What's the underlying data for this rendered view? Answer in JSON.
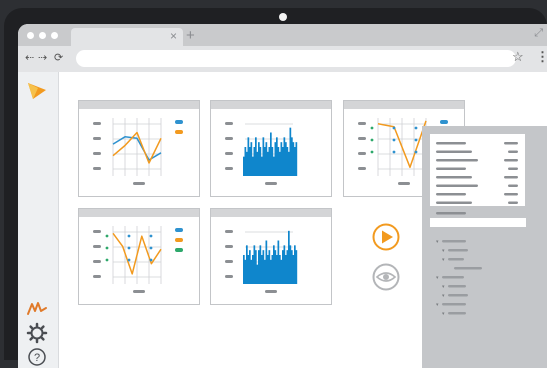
{
  "browser": {
    "new_tab_symbol": "+",
    "tab_close_symbol": "×",
    "back_icon": "arrow-left-icon",
    "forward_icon": "arrow-right-icon",
    "reload_icon": "reload-icon",
    "bookmark_icon": "star-icon",
    "menu_icon": "kebab-menu-icon",
    "url_value": ""
  },
  "sidebar": {
    "logo": "arrow-logo-icon",
    "items": [
      {
        "icon": "signature-icon"
      },
      {
        "icon": "gear-icon"
      },
      {
        "icon": "help-icon",
        "label": "?"
      }
    ]
  },
  "colors": {
    "accent": "#f29a1f",
    "series_blue": "#2f92cf",
    "bar_blue": "#0f86cc",
    "legend_green": "#2ea86b",
    "placeholder": "#8c8f93",
    "inspector_bg": "#c4c6c9"
  },
  "actions": {
    "play_icon": "play-icon",
    "preview_icon": "eye-icon"
  },
  "inspector": {
    "tree_expand_glyph": "▾"
  },
  "chart_data": [
    {
      "type": "line",
      "series": [
        {
          "values": [
            2.2,
            2.7,
            2.6,
            1.1,
            1.6
          ]
        },
        {
          "values": [
            1.4,
            2.1,
            3.0,
            0.9,
            2.6
          ]
        }
      ],
      "ylim": [
        0,
        4
      ]
    },
    {
      "type": "bar",
      "values": [
        2,
        3,
        2.5,
        4,
        3,
        3.5,
        2,
        3,
        4,
        2.5,
        3.5,
        3,
        2,
        4,
        3,
        3.5,
        2.5,
        3,
        4.5,
        3,
        2,
        3.5,
        4,
        3,
        2.5,
        3.5,
        3,
        4,
        3.5,
        3,
        2.5,
        5,
        4,
        3.5,
        3,
        3.5
      ],
      "ylim": [
        0,
        6
      ]
    },
    {
      "type": "line",
      "series": [
        {
          "values": [
            3.6,
            3.4,
            0.6,
            3.8
          ]
        }
      ],
      "ylim": [
        0,
        4
      ]
    },
    {
      "type": "line",
      "series": [
        {
          "values": [
            3.5,
            2.6,
            0.7,
            3.3,
            1.4,
            2.4
          ]
        }
      ],
      "ylim": [
        0,
        4
      ]
    },
    {
      "type": "bar",
      "values": [
        3,
        2.5,
        4,
        3,
        3.5,
        2.5,
        3,
        4,
        3.5,
        2,
        3.5,
        4,
        3,
        3.5,
        2.5,
        4.5,
        3,
        3.5,
        2.5,
        3,
        4,
        3.5,
        3,
        4.5,
        3,
        2.5,
        3.5,
        4,
        3,
        3.5,
        5.5,
        4,
        3.5,
        3,
        4,
        3.5
      ],
      "ylim": [
        0,
        6
      ]
    }
  ]
}
